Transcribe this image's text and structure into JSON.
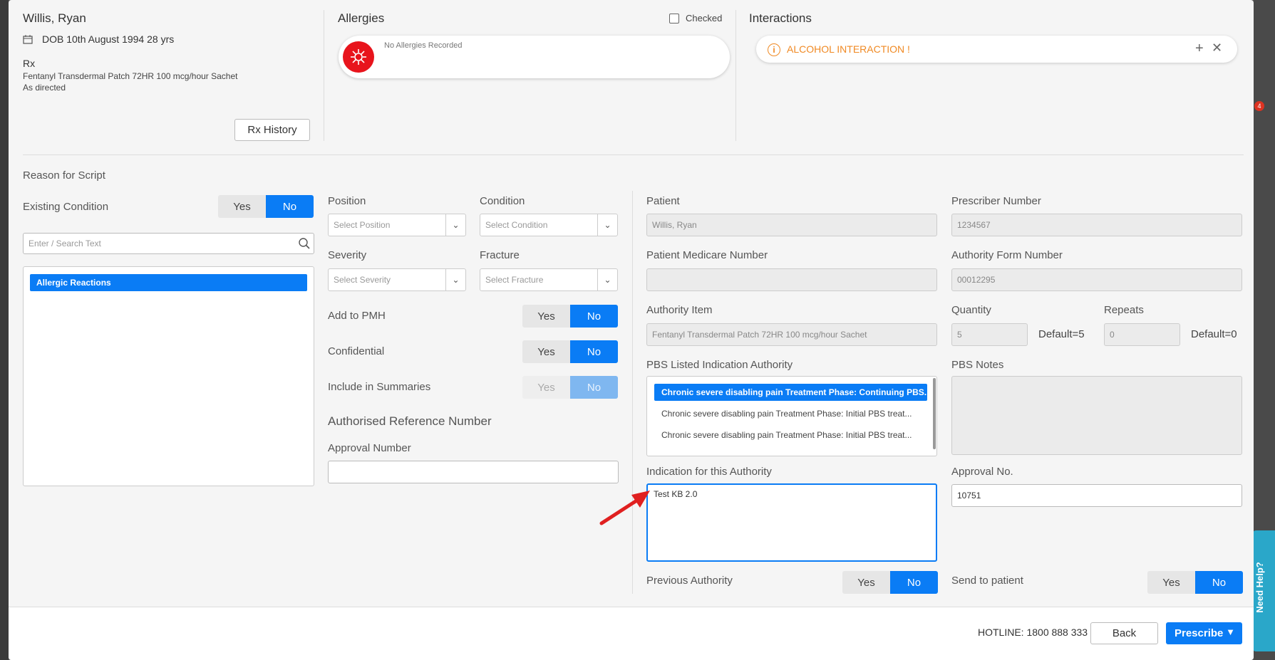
{
  "patient_header": {
    "name": "Willis, Ryan",
    "dob": "DOB 10th August 1994 28 yrs",
    "rx_label": "Rx",
    "rx_drug": "Fentanyl Transdermal Patch 72HR 100 mcg/hour Sachet",
    "rx_directions": "As directed",
    "rx_history_button": "Rx History"
  },
  "allergies": {
    "title": "Allergies",
    "checked_label": "Checked",
    "no_allergies_text": "No Allergies Recorded"
  },
  "interactions": {
    "title": "Interactions",
    "alert_text": "ALCOHOL INTERACTION !"
  },
  "reason": {
    "title": "Reason for Script",
    "existing_condition_label": "Existing Condition",
    "search_placeholder": "Enter / Search Text",
    "list_items": [
      "Allergic Reactions"
    ],
    "yes": "Yes",
    "no": "No"
  },
  "details": {
    "position_label": "Position",
    "position_placeholder": "Select Position",
    "condition_label": "Condition",
    "condition_placeholder": "Select Condition",
    "severity_label": "Severity",
    "severity_placeholder": "Select Severity",
    "fracture_label": "Fracture",
    "fracture_placeholder": "Select Fracture",
    "add_pmh_label": "Add to PMH",
    "confidential_label": "Confidential",
    "include_summaries_label": "Include in Summaries",
    "auth_ref_heading": "Authorised Reference Number",
    "approval_number_label": "Approval Number",
    "approval_number_value": ""
  },
  "authority": {
    "patient_label": "Patient",
    "patient_value": "Willis, Ryan",
    "prescriber_label": "Prescriber Number",
    "prescriber_value": "1234567",
    "medicare_label": "Patient Medicare Number",
    "medicare_value": "",
    "form_number_label": "Authority Form Number",
    "form_number_value": "00012295",
    "item_label": "Authority Item",
    "item_value": "Fentanyl Transdermal Patch 72HR 100 mcg/hour Sachet",
    "quantity_label": "Quantity",
    "quantity_value": "5",
    "quantity_default": "Default=5",
    "repeats_label": "Repeats",
    "repeats_value": "0",
    "repeats_default": "Default=0",
    "pbs_indication_label": "PBS Listed Indication Authority",
    "pbs_options": [
      "Chronic severe disabling pain Treatment Phase: Continuing PBS...",
      "Chronic severe disabling pain Treatment Phase: Initial PBS treat...",
      "Chronic severe disabling pain Treatment Phase: Initial PBS treat..."
    ],
    "pbs_notes_label": "PBS Notes",
    "indication_label": "Indication for this Authority",
    "indication_value": "Test KB 2.0",
    "approval_no_label": "Approval No.",
    "approval_no_value": "10751",
    "previous_authority_label": "Previous Authority",
    "send_patient_label": "Send to patient"
  },
  "footer": {
    "hotline": "HOTLINE: 1800 888 333",
    "back_button": "Back",
    "prescribe_button": "Prescribe"
  },
  "side": {
    "need_help": "Need Help?",
    "notification_count": "4"
  },
  "colors": {
    "accent": "#0a7cf5",
    "alert_orange": "#f08a24",
    "allergy_red": "#e8141c",
    "arrow_red": "#e02020"
  }
}
